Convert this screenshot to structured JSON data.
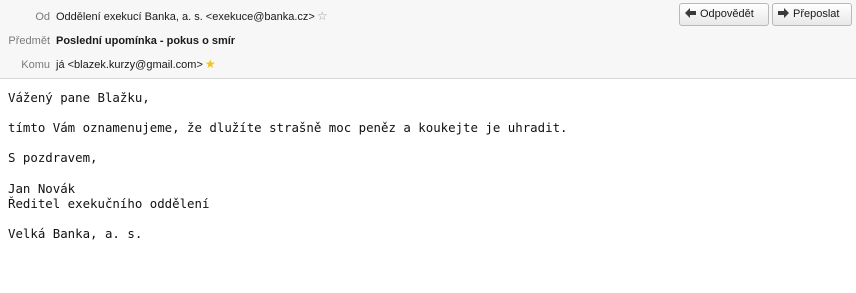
{
  "header": {
    "from_label": "Od",
    "from_value": "Oddělení exekucí Banka, a. s. <exekuce@banka.cz>",
    "subject_label": "Předmět",
    "subject_value": "Poslední upomínka - pokus o smír",
    "to_label": "Komu",
    "to_value": "já <blazek.kurzy@gmail.com>",
    "from_star_icon": "star-outline-icon",
    "to_star_icon": "star-filled-icon"
  },
  "toolbar": {
    "reply_label": "Odpovědět",
    "reply_icon": "reply-arrow-icon",
    "forward_label": "Přeposlat",
    "forward_icon": "forward-arrow-icon"
  },
  "message": {
    "body": "Vážený pane Blažku,\n\ntímto Vám oznamenujeme, že dlužíte strašně moc peněz a koukejte je uhradit.\n\nS pozdravem,\n\nJan Novák\nŘeditel exekučního oddělení\n\nVelká Banka, a. s."
  },
  "colors": {
    "header_bg": "#f7f7f7",
    "label_gray": "#7a7a7a",
    "star_gold": "#f2c318"
  }
}
